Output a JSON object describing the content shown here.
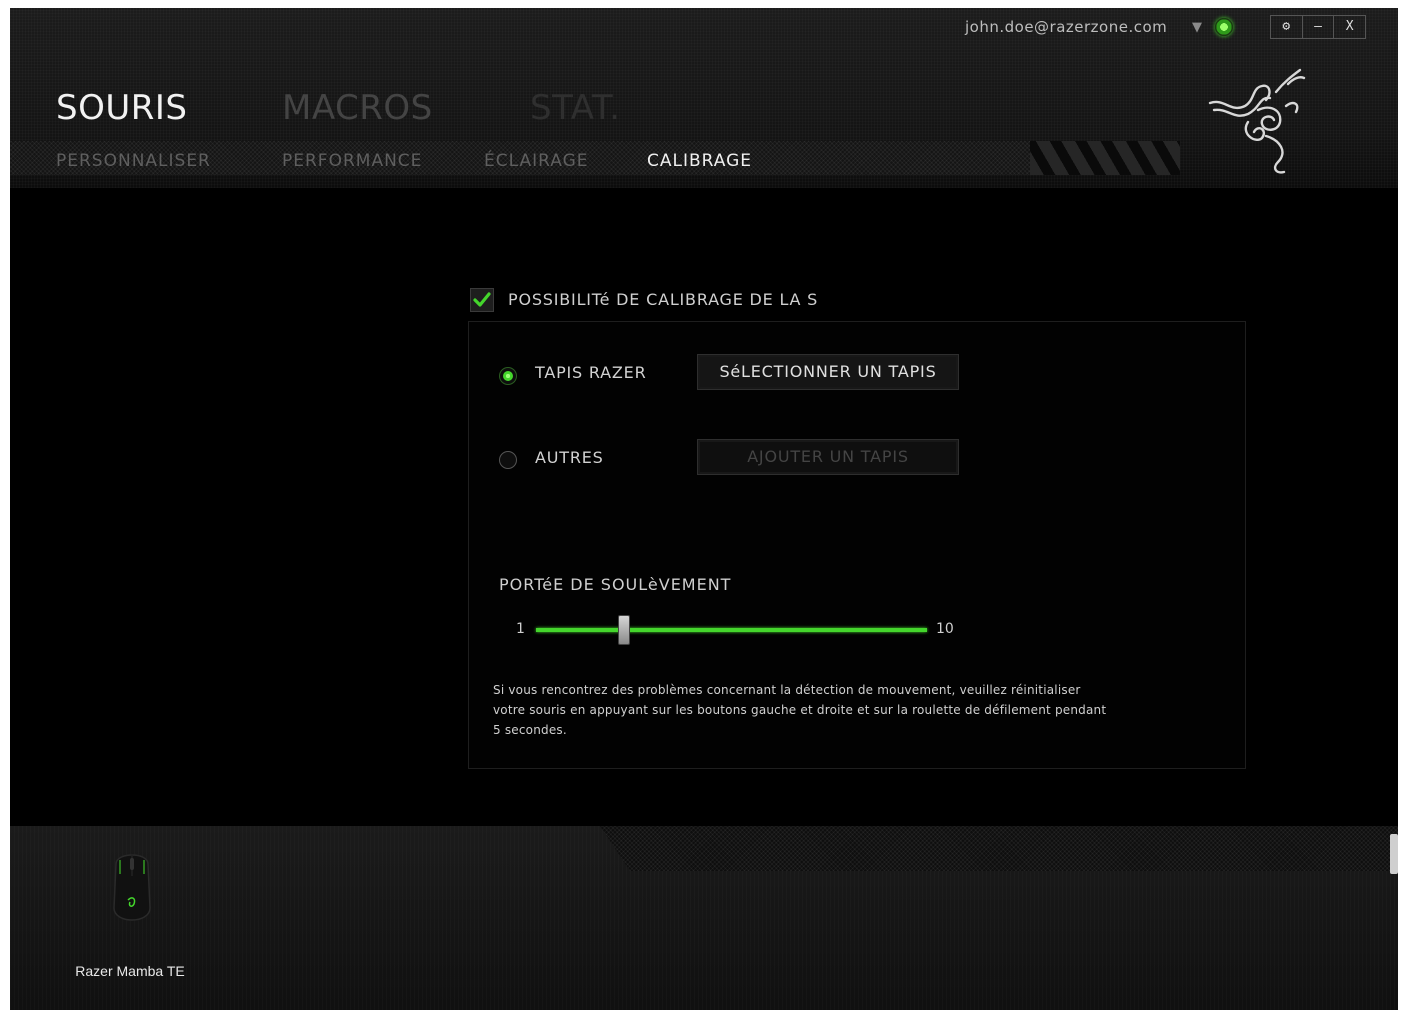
{
  "header": {
    "account_email": "john.doe@razerzone.com",
    "controls": {
      "settings": "⚙",
      "minimize": "–",
      "close": "X"
    }
  },
  "main_tabs": [
    {
      "label": "SOURIS",
      "active": true
    },
    {
      "label": "MACROS",
      "active": false
    },
    {
      "label": "STAT.",
      "active": false
    }
  ],
  "sub_tabs": [
    {
      "label": "PERSONNALISER",
      "active": false
    },
    {
      "label": "PERFORMANCE",
      "active": false
    },
    {
      "label": "ÉCLAIRAGE",
      "active": false
    },
    {
      "label": "CALIBRAGE",
      "active": true
    }
  ],
  "calibration": {
    "enable_label": "POSSIBILITé DE CALIBRAGE DE LA S",
    "enable_checked": true,
    "options": [
      {
        "label": "TAPIS RAZER",
        "selected": true,
        "button_label": "SéLECTIONNER UN TAPIS",
        "button_enabled": true
      },
      {
        "label": "AUTRES",
        "selected": false,
        "button_label": "AJOUTER UN TAPIS",
        "button_enabled": false
      }
    ],
    "liftoff": {
      "label": "PORTéE DE SOULèVEMENT",
      "min": 1,
      "max": 10,
      "min_label": "1",
      "max_label": "10",
      "value": 3
    },
    "note": "Si vous rencontrez des problèmes concernant la détection de mouvement, veuillez réinitialiser votre souris en appuyant sur les boutons gauche et droite et sur la roulette de défilement pendant 5 secondes."
  },
  "device": {
    "name": "Razer Mamba TE",
    "icon": "mouse-icon"
  },
  "colors": {
    "accent": "#44d62c",
    "background": "#000000",
    "text": "#cfcfcf"
  }
}
